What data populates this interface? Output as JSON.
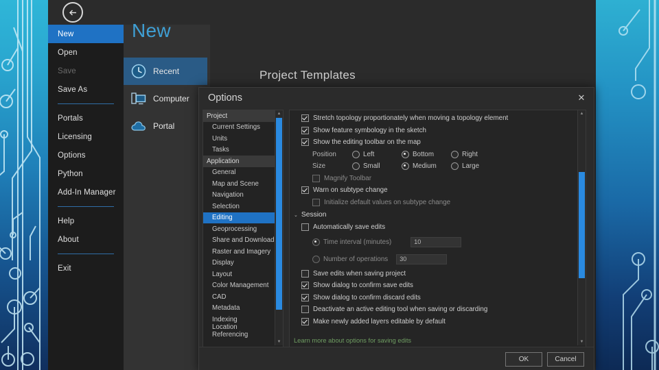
{
  "backstage": {
    "back_label": "←",
    "rail": [
      {
        "label": "New",
        "state": "selected"
      },
      {
        "label": "Open",
        "state": "normal"
      },
      {
        "label": "Save",
        "state": "disabled"
      },
      {
        "label": "Save As",
        "state": "normal"
      },
      {
        "label": "Portals",
        "state": "normal"
      },
      {
        "label": "Licensing",
        "state": "normal"
      },
      {
        "label": "Options",
        "state": "normal"
      },
      {
        "label": "Python",
        "state": "normal"
      },
      {
        "label": "Add-In Manager",
        "state": "normal"
      },
      {
        "label": "Help",
        "state": "normal"
      },
      {
        "label": "About",
        "state": "normal"
      },
      {
        "label": "Exit",
        "state": "normal"
      }
    ],
    "new_title": "New",
    "new_items": [
      {
        "label": "Recent",
        "icon": "clock-icon",
        "state": "selected"
      },
      {
        "label": "Computer",
        "icon": "computer-icon",
        "state": "normal"
      },
      {
        "label": "Portal",
        "icon": "cloud-icon",
        "state": "normal"
      }
    ],
    "templates_header": "Project Templates"
  },
  "dialog": {
    "title": "Options",
    "close_label": "✕",
    "tree": [
      {
        "label": "Project",
        "type": "group"
      },
      {
        "label": "Current Settings",
        "type": "item"
      },
      {
        "label": "Units",
        "type": "item"
      },
      {
        "label": "Tasks",
        "type": "item"
      },
      {
        "label": "Application",
        "type": "group"
      },
      {
        "label": "General",
        "type": "item"
      },
      {
        "label": "Map and Scene",
        "type": "item"
      },
      {
        "label": "Navigation",
        "type": "item"
      },
      {
        "label": "Selection",
        "type": "item"
      },
      {
        "label": "Editing",
        "type": "item",
        "state": "selected"
      },
      {
        "label": "Geoprocessing",
        "type": "item"
      },
      {
        "label": "Share and Download",
        "type": "item"
      },
      {
        "label": "Raster and Imagery",
        "type": "item"
      },
      {
        "label": "Display",
        "type": "item"
      },
      {
        "label": "Layout",
        "type": "item"
      },
      {
        "label": "Color Management",
        "type": "item"
      },
      {
        "label": "CAD",
        "type": "item"
      },
      {
        "label": "Metadata",
        "type": "item"
      },
      {
        "label": "Indexing",
        "type": "item"
      },
      {
        "label": "Location Referencing",
        "type": "item"
      }
    ],
    "options": {
      "stretch_topology": "Stretch topology proportionately when moving a topology element",
      "show_feature_symbology": "Show feature symbology in the sketch",
      "show_editing_toolbar": "Show the editing toolbar on the map",
      "position_label": "Position",
      "position_left": "Left",
      "position_bottom": "Bottom",
      "position_right": "Right",
      "size_label": "Size",
      "size_small": "Small",
      "size_medium": "Medium",
      "size_large": "Large",
      "magnify_toolbar": "Magnify Toolbar",
      "warn_subtype": "Warn on subtype change",
      "initialize_defaults": "Initialize default values on subtype change",
      "session_header": "Session",
      "session_chevron": "⌄",
      "auto_save": "Automatically save edits",
      "time_interval": "Time interval (minutes)",
      "time_interval_value": "10",
      "number_operations": "Number of operations",
      "number_operations_value": "30",
      "save_on_project_save": "Save edits when saving project",
      "confirm_save": "Show dialog to confirm save edits",
      "confirm_discard": "Show dialog to confirm discard edits",
      "deactivate_tool": "Deactivate an active editing tool when saving or discarding",
      "make_editable": "Make newly added layers editable by default",
      "learn_more": "Learn more about options for saving edits"
    },
    "footer": {
      "ok": "OK",
      "cancel": "Cancel"
    }
  },
  "theme": {
    "accent": "#1f72c4",
    "scrollbar": "#2a8ae0",
    "link": "#6f9d62",
    "title_blue": "#3f9fd4"
  }
}
